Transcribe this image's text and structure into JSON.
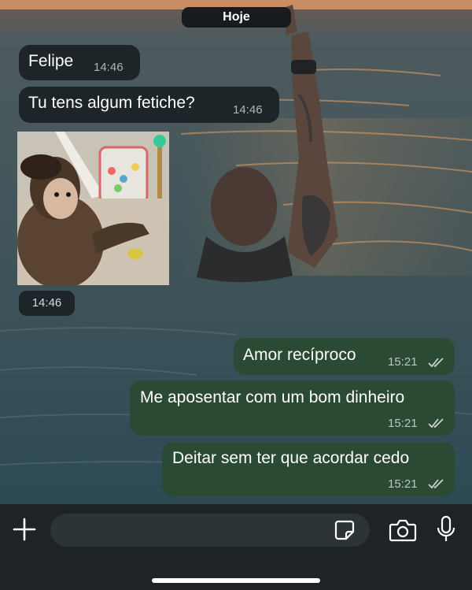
{
  "chat": {
    "date_label": "Hoje",
    "messages": [
      {
        "direction": "incoming",
        "text": "Felipe",
        "time": "14:46"
      },
      {
        "direction": "incoming",
        "text": "Tu tens algum fetiche?",
        "time": "14:46"
      },
      {
        "direction": "incoming",
        "type": "image",
        "time": "14:46"
      },
      {
        "direction": "outgoing",
        "text": "Amor recíproco",
        "time": "15:21",
        "status": "read"
      },
      {
        "direction": "outgoing",
        "text": "Me aposentar com um bom dinheiro",
        "time": "15:21",
        "status": "read"
      },
      {
        "direction": "outgoing",
        "text": "Deitar sem ter que acordar cedo",
        "time": "15:21",
        "status": "read"
      }
    ]
  },
  "composer": {
    "placeholder": "",
    "icons": [
      "plus-icon",
      "sticker-icon",
      "camera-icon",
      "microphone-icon"
    ]
  },
  "colors": {
    "incoming_bubble": "#1e2528",
    "outgoing_bubble": "#2a4a33",
    "composer_bg": "#1d2326",
    "read_ticks": "#c9d3cc"
  }
}
